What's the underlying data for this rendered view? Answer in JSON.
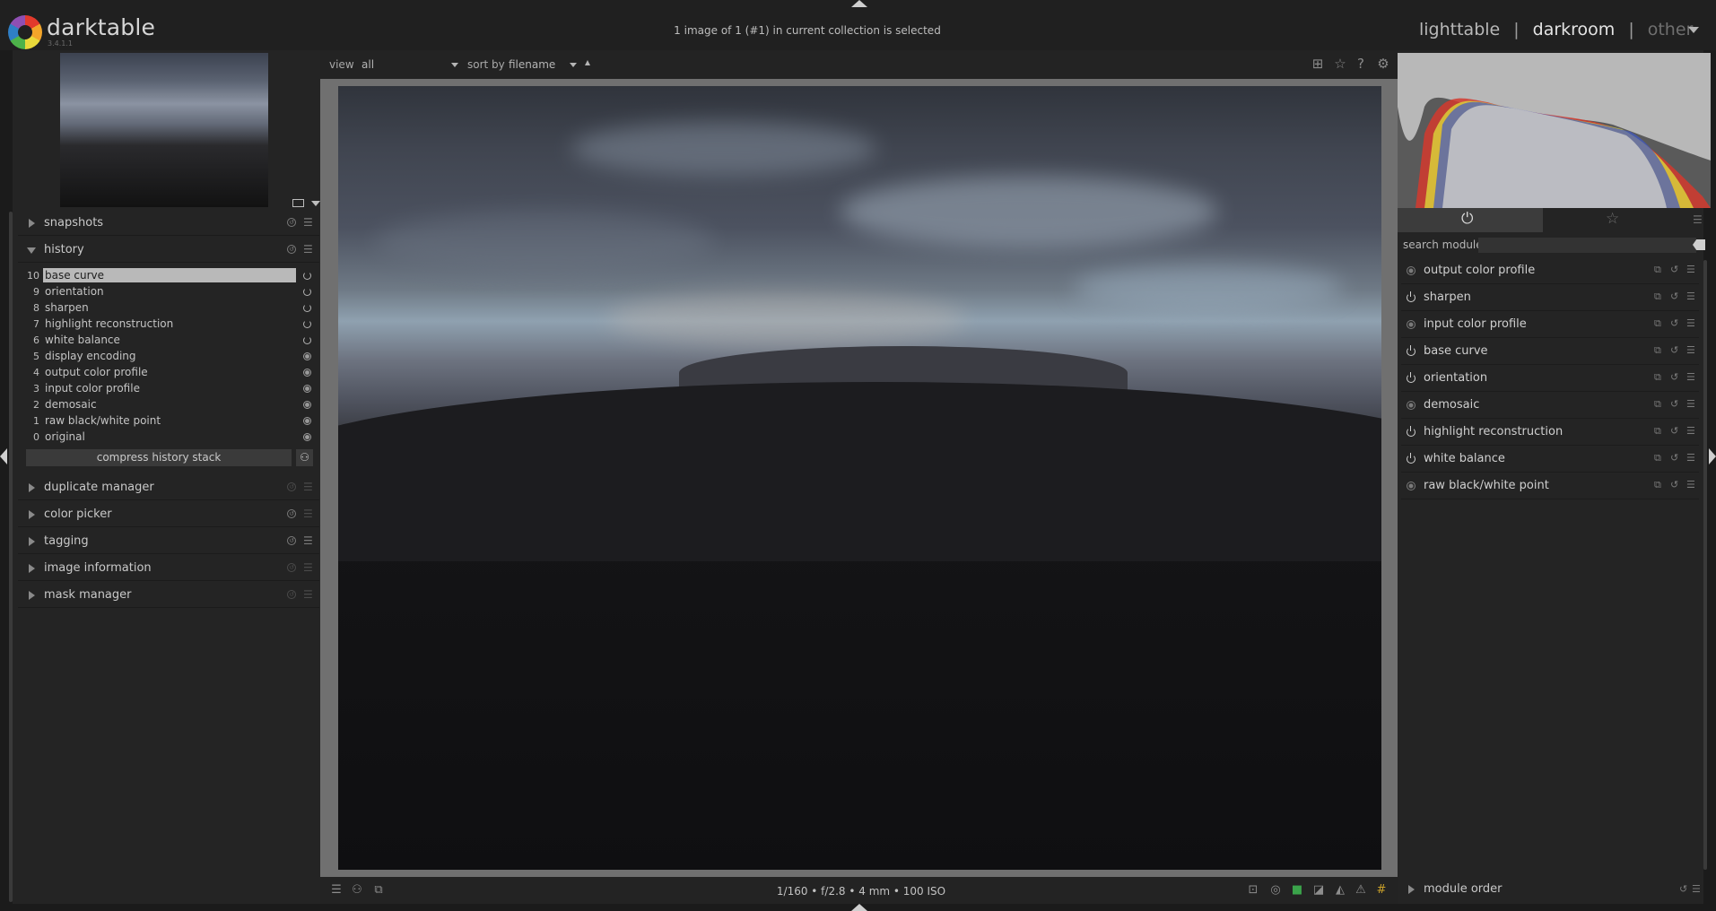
{
  "app": {
    "name": "darktable",
    "version": "3.4.1.1"
  },
  "status_line": "1 image of 1 (#1) in current collection is selected",
  "views": {
    "lighttable": "lighttable",
    "darkroom": "darkroom",
    "other": "other",
    "separator": "|"
  },
  "left_modules_top": [
    {
      "label": "snapshots"
    },
    {
      "label": "history"
    }
  ],
  "history": {
    "items": [
      {
        "num": "10",
        "label": "base curve",
        "active": true
      },
      {
        "num": "9",
        "label": "orientation"
      },
      {
        "num": "8",
        "label": "sharpen"
      },
      {
        "num": "7",
        "label": "highlight reconstruction"
      },
      {
        "num": "6",
        "label": "white balance"
      },
      {
        "num": "5",
        "label": "display encoding"
      },
      {
        "num": "4",
        "label": "output color profile"
      },
      {
        "num": "3",
        "label": "input color profile"
      },
      {
        "num": "2",
        "label": "demosaic"
      },
      {
        "num": "1",
        "label": "raw black/white point"
      },
      {
        "num": "0",
        "label": "original"
      }
    ],
    "compress_label": "compress history stack"
  },
  "left_modules_bottom": [
    {
      "label": "duplicate manager"
    },
    {
      "label": "color picker"
    },
    {
      "label": "tagging"
    },
    {
      "label": "image information"
    },
    {
      "label": "mask manager"
    }
  ],
  "filter": {
    "view_label": "view",
    "view_value": "all",
    "sort_label": "sort by",
    "sort_value": "filename"
  },
  "exif_line": "1/160 • f/2.8 • 4 mm • 100 ISO",
  "search": {
    "label": "search module",
    "value": ""
  },
  "right_modules": [
    {
      "label": "output color profile",
      "state": "off"
    },
    {
      "label": "sharpen",
      "state": "on"
    },
    {
      "label": "input color profile",
      "state": "off"
    },
    {
      "label": "base curve",
      "state": "on"
    },
    {
      "label": "orientation",
      "state": "on"
    },
    {
      "label": "demosaic",
      "state": "off"
    },
    {
      "label": "highlight reconstruction",
      "state": "on"
    },
    {
      "label": "white balance",
      "state": "on"
    },
    {
      "label": "raw black/white point",
      "state": "off"
    }
  ],
  "module_order_label": "module order",
  "icons": {
    "power": "power-icon",
    "favorite": "star-icon",
    "presets": "hamburger-icon",
    "reset": "reset-icon"
  }
}
